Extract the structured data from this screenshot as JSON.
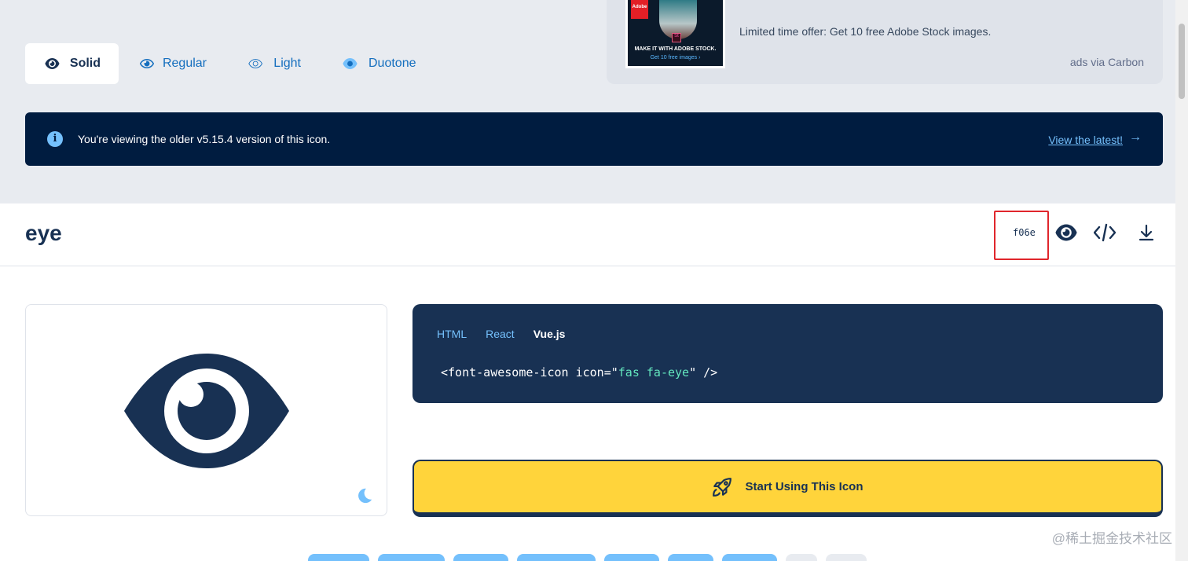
{
  "styles": {
    "tabs": [
      {
        "label": "Solid",
        "icon": "eye-solid-icon",
        "active": true
      },
      {
        "label": "Regular",
        "icon": "eye-regular-icon",
        "active": false
      },
      {
        "label": "Light",
        "icon": "eye-light-icon",
        "active": false
      },
      {
        "label": "Duotone",
        "icon": "eye-duotone-icon",
        "active": false
      }
    ]
  },
  "ad": {
    "image_brand": "Adobe",
    "image_caption_1": "MAKE IT WITH ADOBE STOCK.",
    "image_caption_2": "Get 10 free images ›",
    "text": "Limited time offer: Get 10 free Adobe Stock images.",
    "via": "ads via Carbon"
  },
  "banner": {
    "message": "You're viewing the older v5.15.4 version of this icon.",
    "link": "View the latest!",
    "icon": "info-icon"
  },
  "icon_detail": {
    "name": "eye",
    "unicode": "f06e",
    "actions": [
      "eye-icon",
      "code-icon",
      "download-icon"
    ]
  },
  "code": {
    "tabs": [
      {
        "label": "HTML",
        "active": false
      },
      {
        "label": "React",
        "active": false
      },
      {
        "label": "Vue.js",
        "active": true
      }
    ],
    "snippet_prefix": "<font-awesome-icon icon=\"",
    "snippet_value": "fas fa-eye",
    "snippet_suffix": "\" />"
  },
  "cta": {
    "label": "Start Using This Icon",
    "icon": "rocket-icon"
  },
  "watermark": "@稀土掘金技术社区",
  "colors": {
    "navy": "#183153",
    "banner_bg": "#001c40",
    "accent_blue": "#74c0fc",
    "link_blue": "#146ebe",
    "cta_yellow": "#ffd43b",
    "highlight_red": "#e0262c",
    "page_gray": "#e8ebf0"
  }
}
